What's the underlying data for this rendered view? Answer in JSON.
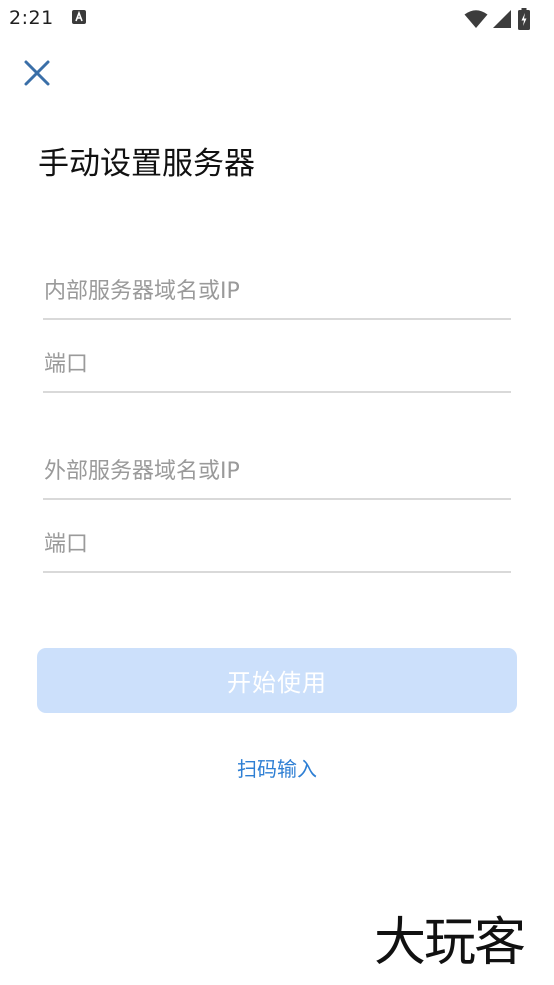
{
  "status_bar": {
    "time": "2:21",
    "app_icon": "a-badge-icon",
    "wifi_icon": "wifi-icon",
    "signal_icon": "signal-icon",
    "battery_icon": "battery-charging-icon"
  },
  "header": {
    "close_icon": "close-icon",
    "title": "手动设置服务器"
  },
  "form": {
    "internal_host_placeholder": "内部服务器域名或IP",
    "internal_host_value": "",
    "internal_port_placeholder": "端口",
    "internal_port_value": "",
    "external_host_placeholder": "外部服务器域名或IP",
    "external_host_value": "",
    "external_port_placeholder": "端口",
    "external_port_value": ""
  },
  "actions": {
    "start_label": "开始使用",
    "scan_label": "扫码输入"
  },
  "watermark": {
    "text": "大玩客"
  },
  "colors": {
    "accent": "#3a6fa8",
    "link": "#2e7fd4",
    "button_disabled_bg": "#cce0fb",
    "divider": "#d9d9d9",
    "placeholder": "#9a9a9a"
  }
}
